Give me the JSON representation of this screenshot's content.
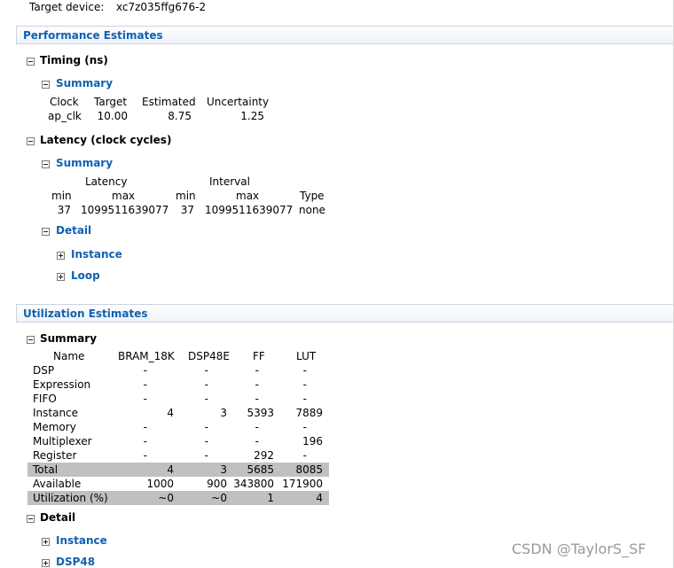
{
  "header": {
    "label": "Target device:",
    "value": "xc7z035ffg676-2"
  },
  "performance": {
    "title": "Performance Estimates",
    "timing": {
      "title": "Timing (ns)",
      "summary_title": "Summary",
      "columns": [
        "Clock",
        "Target",
        "Estimated",
        "Uncertainty"
      ],
      "row": [
        "ap_clk",
        "10.00",
        "8.75",
        "1.25"
      ]
    },
    "latency": {
      "title": "Latency (clock cycles)",
      "summary_title": "Summary",
      "group_headers": [
        "Latency",
        "Interval"
      ],
      "columns": [
        "min",
        "max",
        "min",
        "max",
        "Type"
      ],
      "row": [
        "37",
        "1099511639077",
        "37",
        "1099511639077",
        "none"
      ],
      "detail_title": "Detail",
      "detail_items": [
        "Instance",
        "Loop"
      ]
    }
  },
  "utilization": {
    "title": "Utilization Estimates",
    "summary_title": "Summary",
    "columns": [
      "Name",
      "BRAM_18K",
      "DSP48E",
      "FF",
      "LUT"
    ],
    "rows": [
      [
        "DSP",
        "-",
        "-",
        "-",
        "-"
      ],
      [
        "Expression",
        "-",
        "-",
        "-",
        "-"
      ],
      [
        "FIFO",
        "-",
        "-",
        "-",
        "-"
      ],
      [
        "Instance",
        "4",
        "3",
        "5393",
        "7889"
      ],
      [
        "Memory",
        "-",
        "-",
        "-",
        "-"
      ],
      [
        "Multiplexer",
        "-",
        "-",
        "-",
        "196"
      ],
      [
        "Register",
        "-",
        "-",
        "292",
        "-"
      ],
      [
        "Total",
        "4",
        "3",
        "5685",
        "8085"
      ],
      [
        "Available",
        "1000",
        "900",
        "343800",
        "171900"
      ],
      [
        "Utilization (%)",
        "~0",
        "~0",
        "1",
        "4"
      ]
    ],
    "detail_title": "Detail",
    "detail_items": [
      "Instance",
      "DSP48"
    ]
  },
  "watermark": "CSDN @TaylorS_SF"
}
